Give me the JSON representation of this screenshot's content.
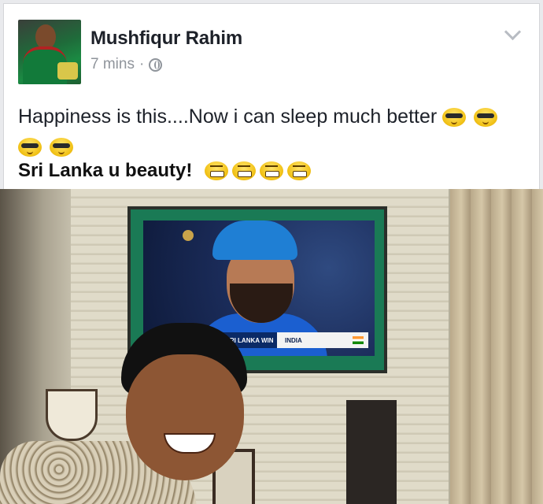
{
  "post": {
    "author": "Mushfiqur Rahim",
    "time": "7 mins",
    "separator": "·",
    "message_line1": "Happiness is this....Now i can sleep much better",
    "message_line2": "Sri Lanka u beauty!"
  },
  "icons": {
    "privacy": "globe-icon",
    "menu": "chevron-down-icon",
    "emoji_cool": "sunglasses-emoji-icon",
    "emoji_grin": "grimace-emoji-icon"
  },
  "photo": {
    "tv_banner_left": "SRI LANKA WIN",
    "tv_banner_right": "INDIA"
  },
  "colors": {
    "text": "#1d2129",
    "meta": "#8f949b",
    "background": "#e9eaed"
  }
}
